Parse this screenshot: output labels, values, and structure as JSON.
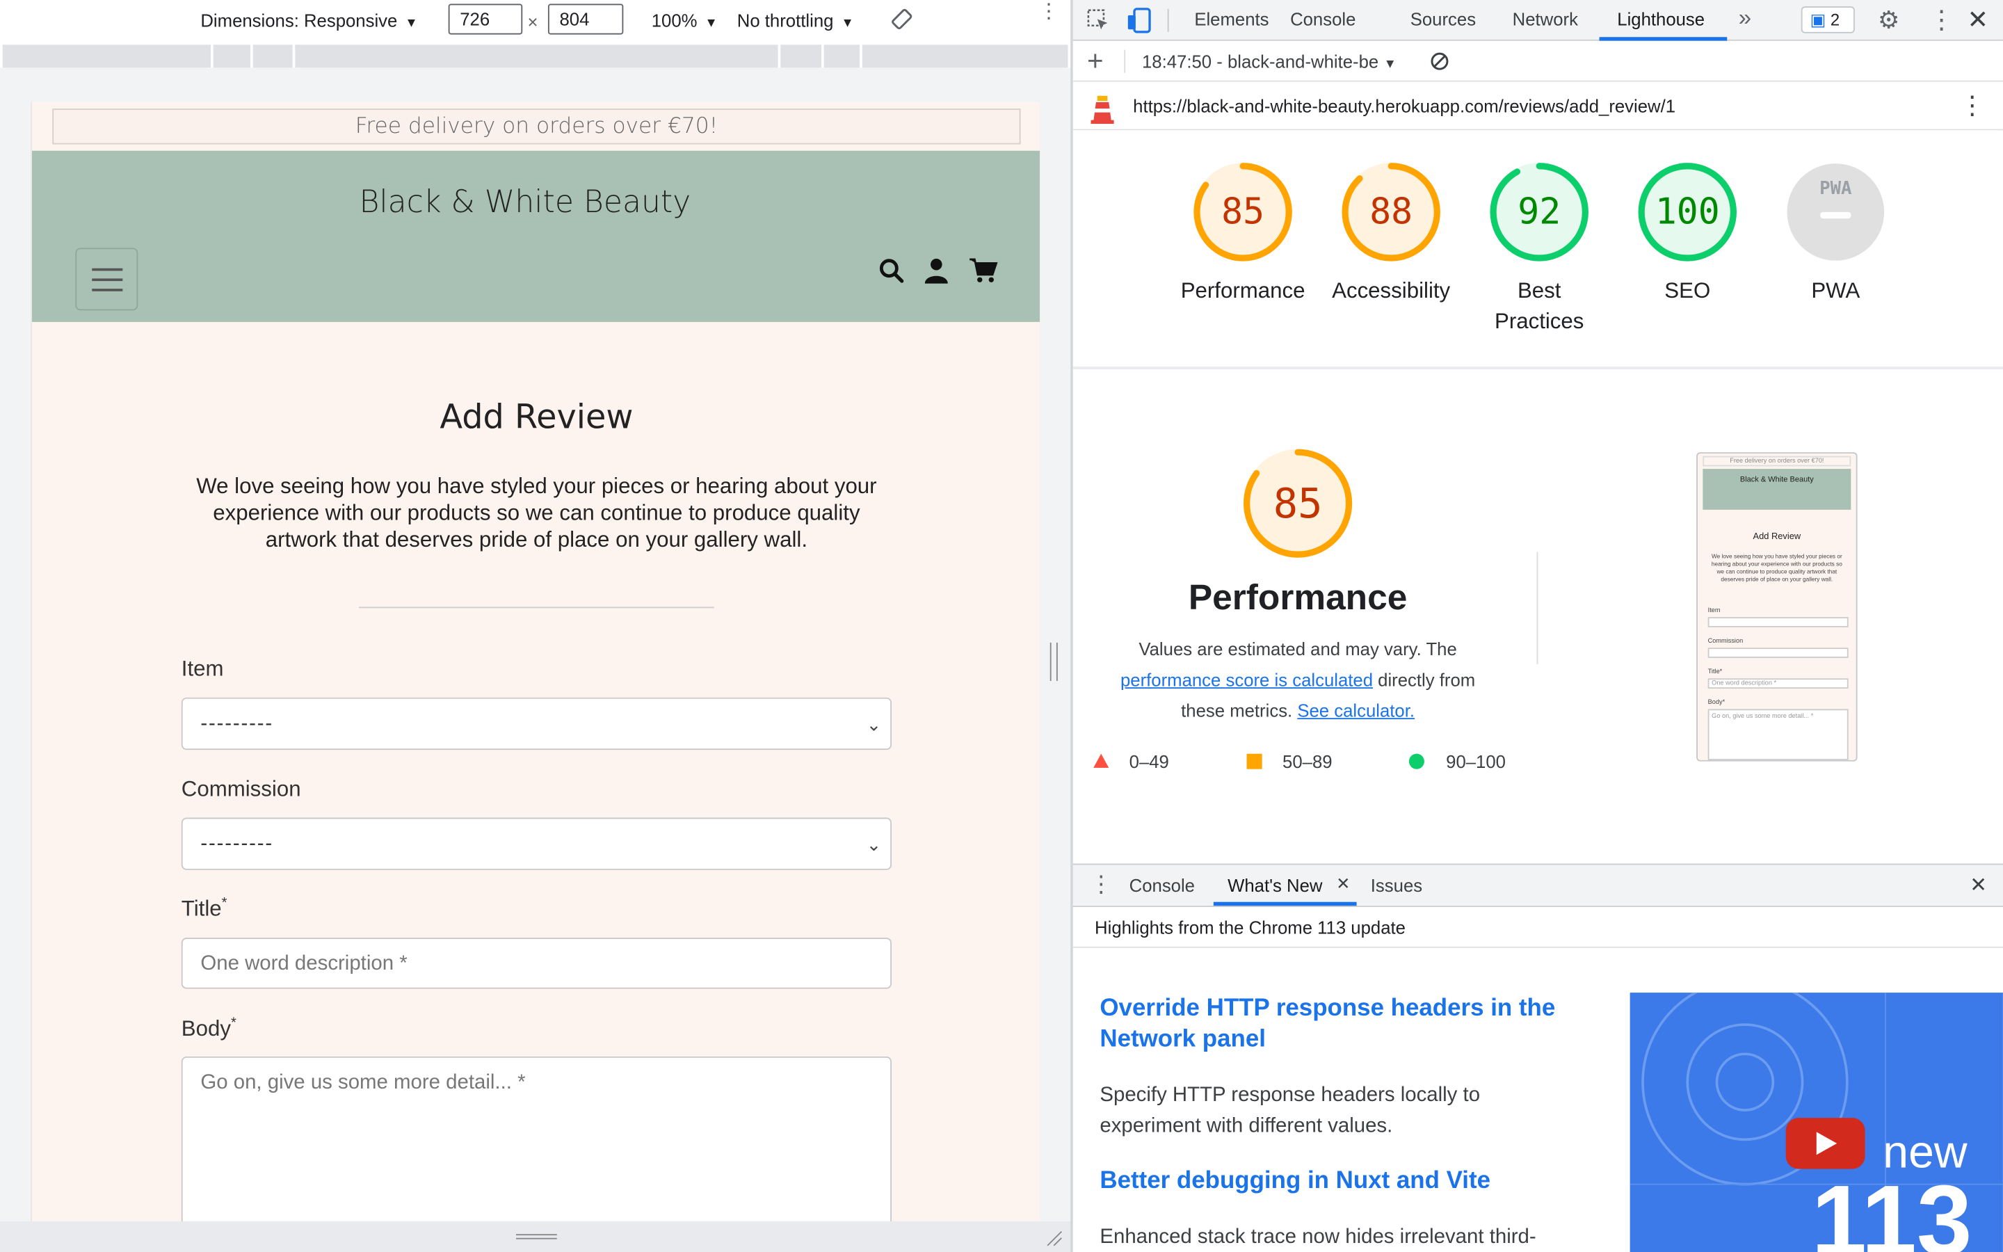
{
  "device_toolbar": {
    "dimensions_label": "Dimensions: Responsive",
    "width": "726",
    "times": "×",
    "height": "804",
    "zoom": "100%",
    "throttling": "No throttling"
  },
  "site": {
    "banner": "Free delivery on orders over €70!",
    "brand": "Black & White Beauty",
    "page_title": "Add Review",
    "intro": "We love seeing how you have styled your pieces or hearing about your experience with our products so we can continue to produce quality artwork that deserves pride of place on your gallery wall.",
    "fields": {
      "item_label": "Item",
      "item_value": "---------",
      "commission_label": "Commission",
      "commission_value": "---------",
      "title_label": "Title",
      "title_placeholder": "One word description *",
      "body_label": "Body",
      "body_placeholder": "Go on, give us some more detail... *",
      "required_mark": "*"
    }
  },
  "devtools": {
    "tabs": [
      "Elements",
      "Console",
      "Sources",
      "Network",
      "Lighthouse"
    ],
    "active_tab": "Lighthouse",
    "issues_count": "2",
    "report_selector": "18:47:50 - black-and-white-be",
    "url": "https://black-and-white-beauty.herokuapp.com/reviews/add_review/1",
    "scores": [
      {
        "label": "Performance",
        "value": 85,
        "color": "#c33300",
        "ring": "#ffa400"
      },
      {
        "label": "Accessibility",
        "value": 88,
        "color": "#c33300",
        "ring": "#ffa400"
      },
      {
        "label": "Best Practices",
        "value": 92,
        "color": "#008800",
        "ring": "#0cce6b"
      },
      {
        "label": "SEO",
        "value": 100,
        "color": "#008800",
        "ring": "#0cce6b"
      },
      {
        "label": "PWA",
        "value": "PWA",
        "color": "#9aa0a6",
        "ring": "#e0e0e0"
      }
    ],
    "perf": {
      "score": "85",
      "title": "Performance",
      "desc_1": "Values are estimated and may vary. The",
      "link_1": "performance score is calculated",
      "desc_2": "directly from",
      "desc_3": "these metrics.",
      "link_2": "See calculator.",
      "legend": [
        {
          "range": "0–49",
          "color": "#ff4e42"
        },
        {
          "range": "50–89",
          "color": "#ffa400"
        },
        {
          "range": "90–100",
          "color": "#0cce6b"
        }
      ]
    },
    "thumbnail": {
      "banner": "Free delivery on orders over €70!",
      "brand": "Black & White Beauty",
      "title": "Add Review",
      "intro": "We love seeing how you have styled your pieces or hearing about your experience with our products so we can continue to produce quality artwork that deserves pride of place on your gallery wall.",
      "item": "Item",
      "commission": "Commission",
      "title_label": "Title*",
      "title_ph": "One word description *",
      "body_label": "Body*",
      "body_ph": "Go on, give us some more detail... *"
    },
    "drawer": {
      "tabs": [
        "Console",
        "What's New",
        "Issues"
      ],
      "active": "What's New",
      "subtitle": "Highlights from the Chrome 113 update",
      "h1": "Override HTTP response headers in the Network panel",
      "p1": "Specify HTTP response headers locally to experiment with different values.",
      "h2": "Better debugging in Nuxt and Vite",
      "p2": "Enhanced stack trace now hides irrelevant third-",
      "video_word": "new",
      "video_num": "113"
    }
  }
}
